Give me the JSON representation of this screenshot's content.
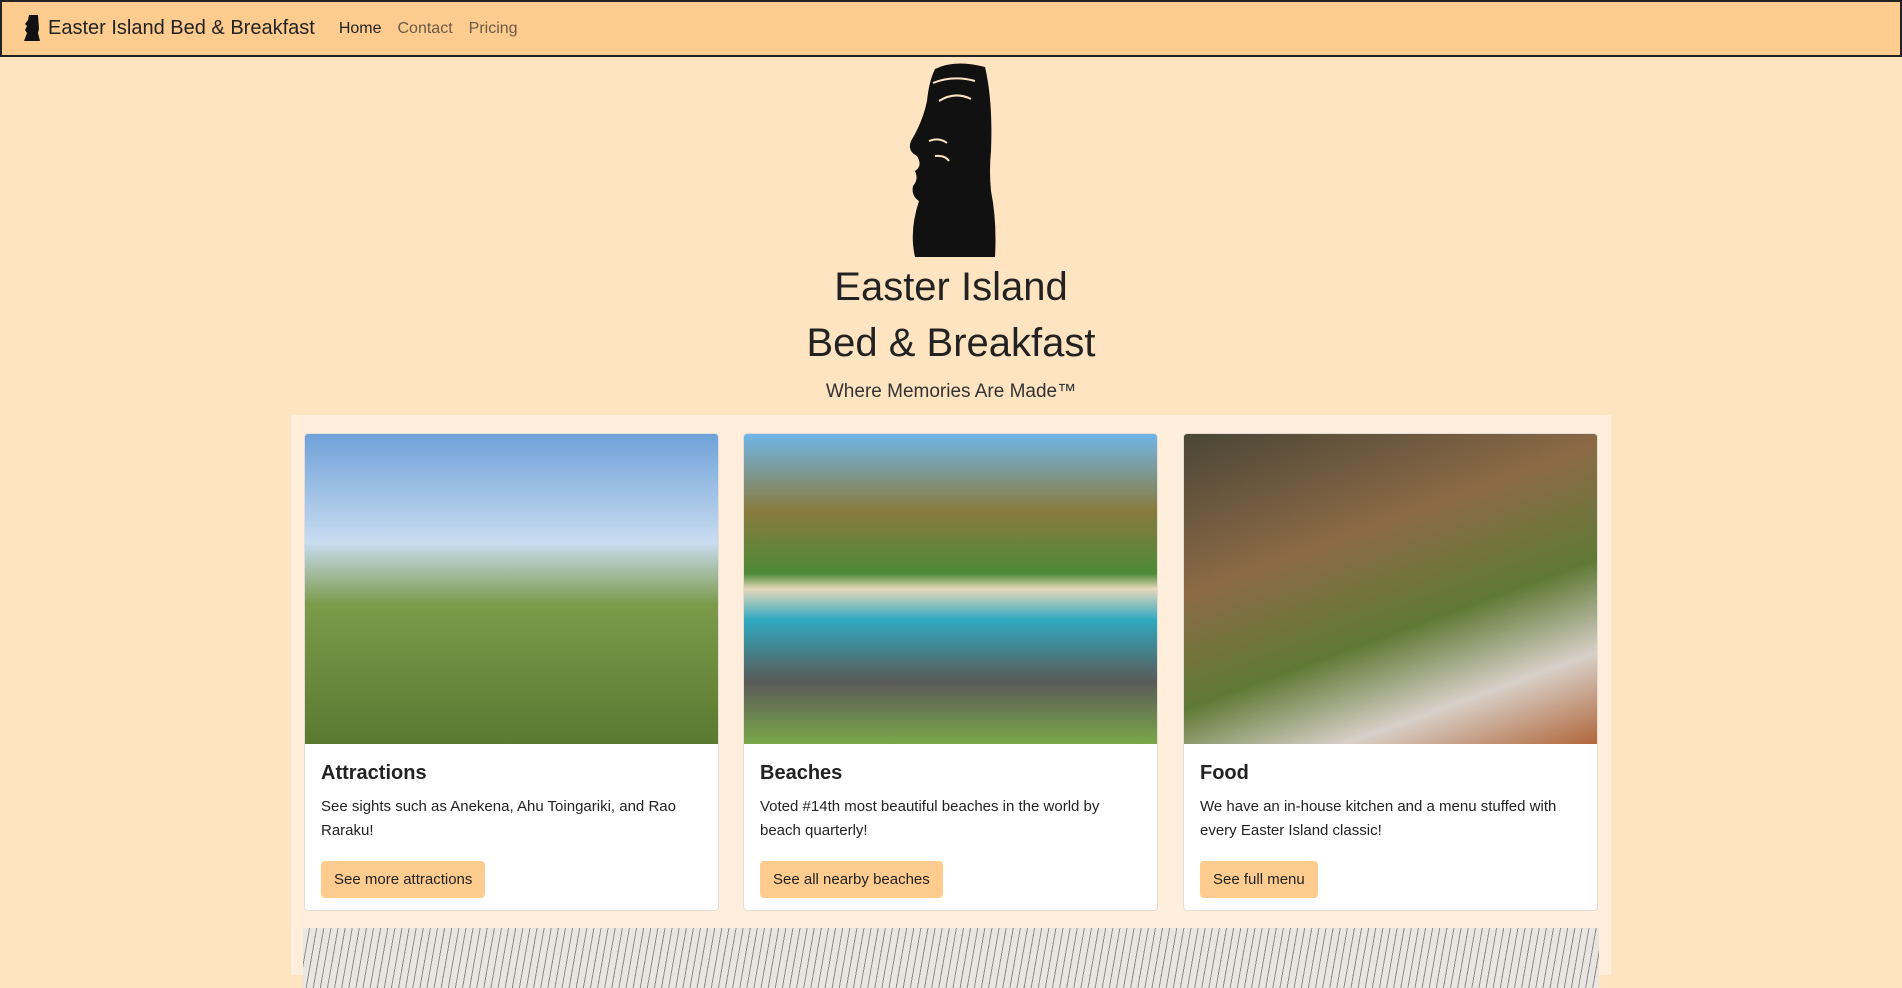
{
  "nav": {
    "brand": "Easter Island Bed & Breakfast",
    "links": [
      "Home",
      "Contact",
      "Pricing"
    ]
  },
  "hero": {
    "title_line1": "Easter Island",
    "title_line2": "Bed & Breakfast",
    "subtitle": "Where Memories Are Made™"
  },
  "cards": [
    {
      "title": "Attractions",
      "text": "See sights such as Anekena, Ahu Toingariki, and Rao Raraku!",
      "button": "See more attractions"
    },
    {
      "title": "Beaches",
      "text": "Voted #14th most beautiful beaches in the world by beach quarterly!",
      "button": "See all nearby beaches"
    },
    {
      "title": "Food",
      "text": "We have an in-house kitchen and a menu stuffed with every Easter Island classic!",
      "button": "See full menu"
    }
  ]
}
